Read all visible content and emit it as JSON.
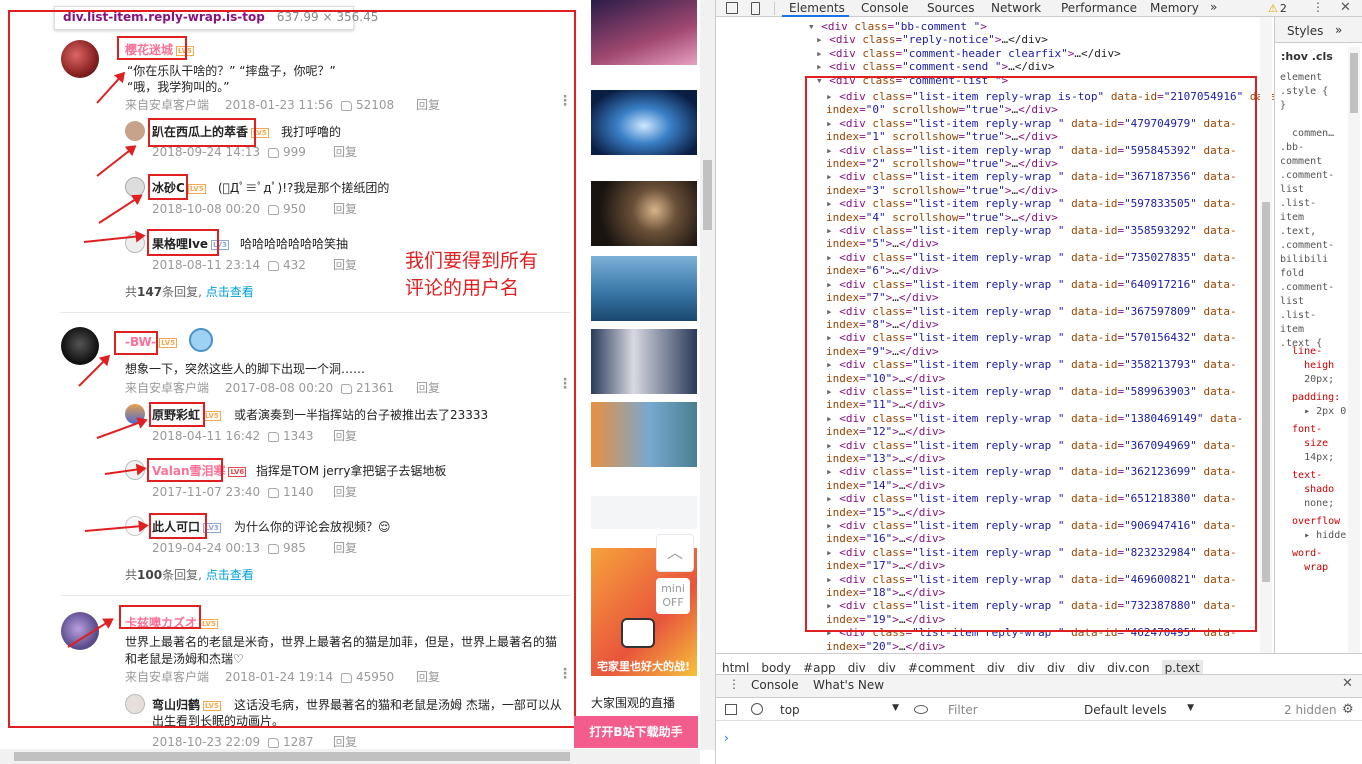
{
  "tooltip": {
    "selector": "div.list-item.reply-wrap.is-top",
    "size": "637.99 × 356.45"
  },
  "annotation": "我们要得到所有\n评论的用户名",
  "comments": [
    {
      "user": "樱花迷城",
      "level": "LV5",
      "text_line1": "“你在乐队干啥的？”  “摔盘子，你呢？”",
      "text_line2": "“哦，我学狗叫的。”",
      "source": "来自安卓客户端",
      "date": "2018-01-23 11:56",
      "likes": "52108",
      "reply": "回复",
      "replies": [
        {
          "user": "趴在西瓜上的萃香",
          "level": "LV5",
          "text": "我打呼噜的",
          "date": "2018-09-24 14:13",
          "likes": "999",
          "reply": "回复"
        },
        {
          "user": "冰砂C",
          "level": "LV5",
          "text": "(ﾟДﾟ≡ﾟдﾟ)!?我是那个搓纸团的",
          "date": "2018-10-08 00:20",
          "likes": "950",
          "reply": "回复"
        },
        {
          "user": "果格哩lve",
          "level": "LV3",
          "text": "哈哈哈哈哈哈哈笑抽",
          "date": "2018-08-11 23:14",
          "likes": "432",
          "reply": "回复"
        }
      ],
      "more_prefix": "共",
      "more_count": "147",
      "more_suffix": "条回复,",
      "more_link": "点击查看"
    },
    {
      "user": "-BW-",
      "level": "LV5",
      "text_line1": "想象一下，突然这些人的脚下出现一个洞……",
      "source": "来自安卓客户端",
      "date": "2017-08-08 00:20",
      "likes": "21361",
      "reply": "回复",
      "replies": [
        {
          "user": "原野彩虹",
          "level": "LV5",
          "text": "或者演奏到一半指挥站的台子被推出去了23333",
          "date": "2018-04-11 16:42",
          "likes": "1343",
          "reply": "回复"
        },
        {
          "user": "Valan雪泪寒",
          "level": "LV6",
          "text": "指挥是TOM  jerry拿把锯子去锯地板",
          "date": "2017-11-07 23:40",
          "likes": "1140",
          "reply": "回复"
        },
        {
          "user": "此人可口",
          "level": "LV3",
          "text": "为什么你的评论会放视频？😌",
          "date": "2019-04-24 00:13",
          "likes": "985",
          "reply": "回复"
        }
      ],
      "more_prefix": "共",
      "more_count": "100",
      "more_suffix": "条回复,",
      "more_link": "点击查看"
    },
    {
      "user": "卡兹噢カズオ",
      "level": "LV5",
      "text_line1": "世界上最著名的老鼠是米奇，世界上最著名的猫是加菲，但是，世界上最著名的猫",
      "text_line2": "和老鼠是汤姆和杰瑞♡",
      "source": "来自安卓客户端",
      "date": "2018-01-24 19:14",
      "likes": "45950",
      "reply": "回复",
      "replies": [
        {
          "user": "弯山归鹤",
          "level": "LV5",
          "text": "这话没毛病，世界最著名的猫和老鼠是汤姆 杰瑞，一部可以从",
          "text2": "出生看到长眠的动画片。",
          "date": "2018-10-23 22:09",
          "likes": "1287",
          "reply": "回复"
        }
      ]
    }
  ],
  "sidebar": {
    "mini": "mini",
    "off": "OFF",
    "banner_text": "宅家里也好大的战!",
    "caption": "大家围观的直播",
    "download_button": "打开B站下载助手"
  },
  "devtools": {
    "tabs": [
      "Elements",
      "Console",
      "Sources",
      "Network",
      "Performance",
      "Memory",
      "»"
    ],
    "warn_count": "2",
    "styles_tabs": [
      "Styles",
      "»"
    ],
    "filter": ":hov .cls",
    "breadcrumbs": [
      "html",
      "body",
      "#app",
      "div",
      "div",
      "#comment",
      "div",
      "div",
      "div",
      "div",
      "div.con",
      "p.text"
    ],
    "drawer_tabs": [
      "Console",
      "What's New"
    ],
    "context": "top",
    "console_filter": "Filter",
    "levels": "Default levels",
    "hidden": "2 hidden",
    "dom_header": [
      {
        "tag": "div",
        "cls": "bb-comment ",
        "tail": ""
      },
      {
        "tag": "div",
        "cls": "reply-notice",
        "tail": "…</div>"
      },
      {
        "tag": "div",
        "cls": "comment-header clearfix",
        "tail": "…</div>"
      },
      {
        "tag": "div",
        "cls": "comment-send ",
        "tail": "…</div>"
      },
      {
        "tag": "div",
        "cls": "comment-list ",
        "tail": ""
      }
    ],
    "list_items": [
      {
        "id": "2107054916",
        "index": "0",
        "top": true
      },
      {
        "id": "479704979",
        "index": "1"
      },
      {
        "id": "595845392",
        "index": "2"
      },
      {
        "id": "367187356",
        "index": "3"
      },
      {
        "id": "597833505",
        "index": "4"
      },
      {
        "id": "358593292",
        "index": "5"
      },
      {
        "id": "735027835",
        "index": "6"
      },
      {
        "id": "640917216",
        "index": "7"
      },
      {
        "id": "367597809",
        "index": "8"
      },
      {
        "id": "570156432",
        "index": "9"
      },
      {
        "id": "358213793",
        "index": "10"
      },
      {
        "id": "589963903",
        "index": "11"
      },
      {
        "id": "1380469149",
        "index": "12"
      },
      {
        "id": "367094969",
        "index": "13"
      },
      {
        "id": "362123699",
        "index": "14"
      },
      {
        "id": "651218380",
        "index": "15"
      },
      {
        "id": "906947416",
        "index": "16"
      },
      {
        "id": "823232984",
        "index": "17"
      },
      {
        "id": "469600821",
        "index": "18"
      },
      {
        "id": "732387880",
        "index": "19"
      },
      {
        "id": "462470495",
        "index": "20"
      }
    ],
    "styles_text": "element\n.style {\n}\n\n  commen…\n.bb-\ncomment\n.comment-\nlist\n.list-\nitem\n.text,\n.comment-\nbilibili\nfold\n.comment-\nlist\n.list-\nitem\n.text {",
    "style_props": [
      {
        "name": "line-",
        "name2": "heigh",
        "val": "20px;"
      },
      {
        "name": "padding:",
        "name2": "",
        "val": "▸ 2px 0;"
      },
      {
        "name": "font-",
        "name2": "size",
        "val": "14px;"
      },
      {
        "name": "text-",
        "name2": "shado",
        "val": "none;"
      },
      {
        "name": "overflow",
        "name2": "",
        "val": "▸ hidde"
      },
      {
        "name": "word-",
        "name2": "wrap",
        "val": ""
      }
    ]
  }
}
